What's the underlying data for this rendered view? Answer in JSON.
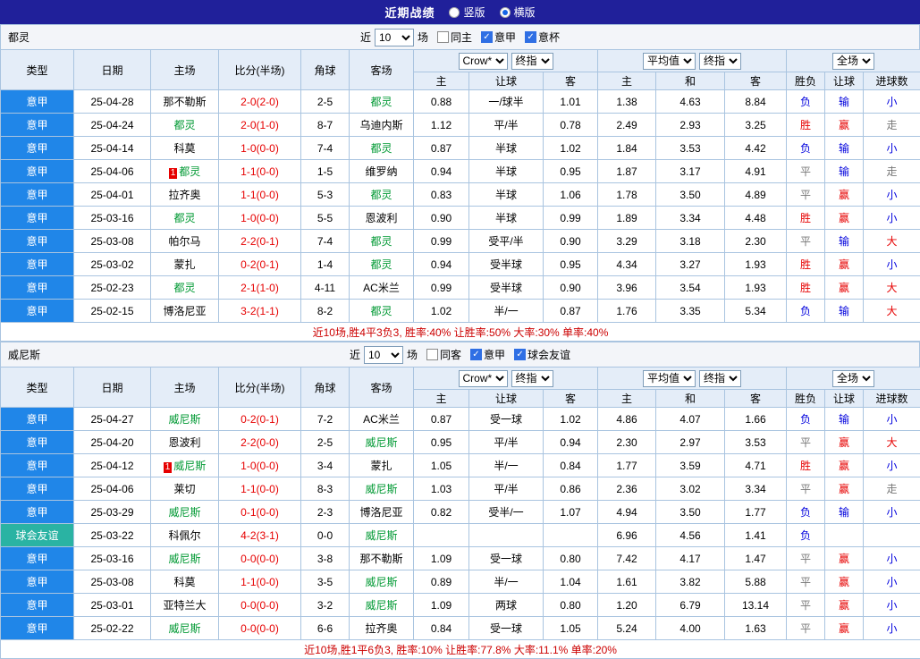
{
  "topbar": {
    "title": "近期战绩",
    "options": [
      {
        "label": "竖版",
        "selected": false
      },
      {
        "label": "横版",
        "selected": true
      }
    ]
  },
  "colors": {
    "topbar_bg": "#20209a",
    "league_blue": "#2086e8",
    "league_teal": "#2ab3a3",
    "focus_team_green": "#009933",
    "score_red": "#e60000",
    "win_red": "#e60000",
    "loss_blue": "#0000dd",
    "push_gray": "#777777",
    "header_bg": "#e4edf8",
    "grid_border": "#a9c4e0"
  },
  "table": {
    "main_columns": [
      "类型",
      "日期",
      "主场",
      "比分(半场)",
      "角球",
      "客场"
    ],
    "sub_columns": [
      "主",
      "让球",
      "客",
      "主",
      "和",
      "客",
      "胜负",
      "让球",
      "进球数"
    ]
  },
  "sections": [
    {
      "team": "都灵",
      "filter": {
        "near_label": "近",
        "count": "10",
        "games_label": "场",
        "checkboxes": [
          {
            "label": "同主",
            "checked": false
          },
          {
            "label": "意甲",
            "checked": true
          },
          {
            "label": "意杯",
            "checked": true
          }
        ]
      },
      "selects": {
        "bookmaker": "Crow*",
        "bookmaker_index": "终指",
        "average": "平均值",
        "average_index": "终指",
        "scope": "全场"
      },
      "rows": [
        {
          "league": "意甲",
          "league_color": "blue",
          "date": "25-04-28",
          "home": {
            "name": "那不勒斯",
            "focus": false,
            "red_card": ""
          },
          "score": "2-0(2-0)",
          "corners": "2-5",
          "away": {
            "name": "都灵",
            "focus": true,
            "red_card": ""
          },
          "odds": [
            "0.88",
            "一/球半",
            "1.01"
          ],
          "avg": [
            "1.38",
            "4.63",
            "8.84"
          ],
          "outcome": [
            {
              "t": "负",
              "c": "blue"
            },
            {
              "t": "输",
              "c": "blue"
            },
            {
              "t": "小",
              "c": "blue"
            }
          ]
        },
        {
          "league": "意甲",
          "league_color": "blue",
          "date": "25-04-24",
          "home": {
            "name": "都灵",
            "focus": true,
            "red_card": ""
          },
          "score": "2-0(1-0)",
          "corners": "8-7",
          "away": {
            "name": "乌迪内斯",
            "focus": false,
            "red_card": ""
          },
          "odds": [
            "1.12",
            "平/半",
            "0.78"
          ],
          "avg": [
            "2.49",
            "2.93",
            "3.25"
          ],
          "outcome": [
            {
              "t": "胜",
              "c": "red"
            },
            {
              "t": "赢",
              "c": "red"
            },
            {
              "t": "走",
              "c": "gray"
            }
          ]
        },
        {
          "league": "意甲",
          "league_color": "blue",
          "date": "25-04-14",
          "home": {
            "name": "科莫",
            "focus": false,
            "red_card": ""
          },
          "score": "1-0(0-0)",
          "corners": "7-4",
          "away": {
            "name": "都灵",
            "focus": true,
            "red_card": ""
          },
          "odds": [
            "0.87",
            "半球",
            "1.02"
          ],
          "avg": [
            "1.84",
            "3.53",
            "4.42"
          ],
          "outcome": [
            {
              "t": "负",
              "c": "blue"
            },
            {
              "t": "输",
              "c": "blue"
            },
            {
              "t": "小",
              "c": "blue"
            }
          ]
        },
        {
          "league": "意甲",
          "league_color": "blue",
          "date": "25-04-06",
          "home": {
            "name": "都灵",
            "focus": true,
            "red_card": "1"
          },
          "score": "1-1(0-0)",
          "corners": "1-5",
          "away": {
            "name": "维罗纳",
            "focus": false,
            "red_card": ""
          },
          "odds": [
            "0.94",
            "半球",
            "0.95"
          ],
          "avg": [
            "1.87",
            "3.17",
            "4.91"
          ],
          "outcome": [
            {
              "t": "平",
              "c": "gray"
            },
            {
              "t": "输",
              "c": "blue"
            },
            {
              "t": "走",
              "c": "gray"
            }
          ]
        },
        {
          "league": "意甲",
          "league_color": "blue",
          "date": "25-04-01",
          "home": {
            "name": "拉齐奥",
            "focus": false,
            "red_card": ""
          },
          "score": "1-1(0-0)",
          "corners": "5-3",
          "away": {
            "name": "都灵",
            "focus": true,
            "red_card": ""
          },
          "odds": [
            "0.83",
            "半球",
            "1.06"
          ],
          "avg": [
            "1.78",
            "3.50",
            "4.89"
          ],
          "outcome": [
            {
              "t": "平",
              "c": "gray"
            },
            {
              "t": "赢",
              "c": "red"
            },
            {
              "t": "小",
              "c": "blue"
            }
          ]
        },
        {
          "league": "意甲",
          "league_color": "blue",
          "date": "25-03-16",
          "home": {
            "name": "都灵",
            "focus": true,
            "red_card": ""
          },
          "score": "1-0(0-0)",
          "corners": "5-5",
          "away": {
            "name": "恩波利",
            "focus": false,
            "red_card": ""
          },
          "odds": [
            "0.90",
            "半球",
            "0.99"
          ],
          "avg": [
            "1.89",
            "3.34",
            "4.48"
          ],
          "outcome": [
            {
              "t": "胜",
              "c": "red"
            },
            {
              "t": "赢",
              "c": "red"
            },
            {
              "t": "小",
              "c": "blue"
            }
          ]
        },
        {
          "league": "意甲",
          "league_color": "blue",
          "date": "25-03-08",
          "home": {
            "name": "帕尔马",
            "focus": false,
            "red_card": ""
          },
          "score": "2-2(0-1)",
          "corners": "7-4",
          "away": {
            "name": "都灵",
            "focus": true,
            "red_card": ""
          },
          "odds": [
            "0.99",
            "受平/半",
            "0.90"
          ],
          "avg": [
            "3.29",
            "3.18",
            "2.30"
          ],
          "outcome": [
            {
              "t": "平",
              "c": "gray"
            },
            {
              "t": "输",
              "c": "blue"
            },
            {
              "t": "大",
              "c": "red"
            }
          ]
        },
        {
          "league": "意甲",
          "league_color": "blue",
          "date": "25-03-02",
          "home": {
            "name": "蒙扎",
            "focus": false,
            "red_card": ""
          },
          "score": "0-2(0-1)",
          "corners": "1-4",
          "away": {
            "name": "都灵",
            "focus": true,
            "red_card": ""
          },
          "odds": [
            "0.94",
            "受半球",
            "0.95"
          ],
          "avg": [
            "4.34",
            "3.27",
            "1.93"
          ],
          "outcome": [
            {
              "t": "胜",
              "c": "red"
            },
            {
              "t": "赢",
              "c": "red"
            },
            {
              "t": "小",
              "c": "blue"
            }
          ]
        },
        {
          "league": "意甲",
          "league_color": "blue",
          "date": "25-02-23",
          "home": {
            "name": "都灵",
            "focus": true,
            "red_card": ""
          },
          "score": "2-1(1-0)",
          "corners": "4-11",
          "away": {
            "name": "AC米兰",
            "focus": false,
            "red_card": ""
          },
          "odds": [
            "0.99",
            "受半球",
            "0.90"
          ],
          "avg": [
            "3.96",
            "3.54",
            "1.93"
          ],
          "outcome": [
            {
              "t": "胜",
              "c": "red"
            },
            {
              "t": "赢",
              "c": "red"
            },
            {
              "t": "大",
              "c": "red"
            }
          ]
        },
        {
          "league": "意甲",
          "league_color": "blue",
          "date": "25-02-15",
          "home": {
            "name": "博洛尼亚",
            "focus": false,
            "red_card": ""
          },
          "score": "3-2(1-1)",
          "corners": "8-2",
          "away": {
            "name": "都灵",
            "focus": true,
            "red_card": ""
          },
          "odds": [
            "1.02",
            "半/一",
            "0.87"
          ],
          "avg": [
            "1.76",
            "3.35",
            "5.34"
          ],
          "outcome": [
            {
              "t": "负",
              "c": "blue"
            },
            {
              "t": "输",
              "c": "blue"
            },
            {
              "t": "大",
              "c": "red"
            }
          ]
        }
      ],
      "summary": "近10场,胜4平3负3, 胜率:40% 让胜率:50% 大率:30% 单率:40%"
    },
    {
      "team": "威尼斯",
      "filter": {
        "near_label": "近",
        "count": "10",
        "games_label": "场",
        "checkboxes": [
          {
            "label": "同客",
            "checked": false
          },
          {
            "label": "意甲",
            "checked": true
          },
          {
            "label": "球会友谊",
            "checked": true
          }
        ]
      },
      "selects": {
        "bookmaker": "Crow*",
        "bookmaker_index": "终指",
        "average": "平均值",
        "average_index": "终指",
        "scope": "全场"
      },
      "rows": [
        {
          "league": "意甲",
          "league_color": "blue",
          "date": "25-04-27",
          "home": {
            "name": "威尼斯",
            "focus": true,
            "red_card": ""
          },
          "score": "0-2(0-1)",
          "corners": "7-2",
          "away": {
            "name": "AC米兰",
            "focus": false,
            "red_card": ""
          },
          "odds": [
            "0.87",
            "受一球",
            "1.02"
          ],
          "avg": [
            "4.86",
            "4.07",
            "1.66"
          ],
          "outcome": [
            {
              "t": "负",
              "c": "blue"
            },
            {
              "t": "输",
              "c": "blue"
            },
            {
              "t": "小",
              "c": "blue"
            }
          ]
        },
        {
          "league": "意甲",
          "league_color": "blue",
          "date": "25-04-20",
          "home": {
            "name": "恩波利",
            "focus": false,
            "red_card": ""
          },
          "score": "2-2(0-0)",
          "corners": "2-5",
          "away": {
            "name": "威尼斯",
            "focus": true,
            "red_card": ""
          },
          "odds": [
            "0.95",
            "平/半",
            "0.94"
          ],
          "avg": [
            "2.30",
            "2.97",
            "3.53"
          ],
          "outcome": [
            {
              "t": "平",
              "c": "gray"
            },
            {
              "t": "赢",
              "c": "red"
            },
            {
              "t": "大",
              "c": "red"
            }
          ]
        },
        {
          "league": "意甲",
          "league_color": "blue",
          "date": "25-04-12",
          "home": {
            "name": "威尼斯",
            "focus": true,
            "red_card": "1"
          },
          "score": "1-0(0-0)",
          "corners": "3-4",
          "away": {
            "name": "蒙扎",
            "focus": false,
            "red_card": ""
          },
          "odds": [
            "1.05",
            "半/一",
            "0.84"
          ],
          "avg": [
            "1.77",
            "3.59",
            "4.71"
          ],
          "outcome": [
            {
              "t": "胜",
              "c": "red"
            },
            {
              "t": "赢",
              "c": "red"
            },
            {
              "t": "小",
              "c": "blue"
            }
          ]
        },
        {
          "league": "意甲",
          "league_color": "blue",
          "date": "25-04-06",
          "home": {
            "name": "莱切",
            "focus": false,
            "red_card": ""
          },
          "score": "1-1(0-0)",
          "corners": "8-3",
          "away": {
            "name": "威尼斯",
            "focus": true,
            "red_card": ""
          },
          "odds": [
            "1.03",
            "平/半",
            "0.86"
          ],
          "avg": [
            "2.36",
            "3.02",
            "3.34"
          ],
          "outcome": [
            {
              "t": "平",
              "c": "gray"
            },
            {
              "t": "赢",
              "c": "red"
            },
            {
              "t": "走",
              "c": "gray"
            }
          ]
        },
        {
          "league": "意甲",
          "league_color": "blue",
          "date": "25-03-29",
          "home": {
            "name": "威尼斯",
            "focus": true,
            "red_card": ""
          },
          "score": "0-1(0-0)",
          "corners": "2-3",
          "away": {
            "name": "博洛尼亚",
            "focus": false,
            "red_card": ""
          },
          "odds": [
            "0.82",
            "受半/一",
            "1.07"
          ],
          "avg": [
            "4.94",
            "3.50",
            "1.77"
          ],
          "outcome": [
            {
              "t": "负",
              "c": "blue"
            },
            {
              "t": "输",
              "c": "blue"
            },
            {
              "t": "小",
              "c": "blue"
            }
          ]
        },
        {
          "league": "球会友谊",
          "league_color": "teal",
          "date": "25-03-22",
          "home": {
            "name": "科佩尔",
            "focus": false,
            "red_card": ""
          },
          "score": "4-2(3-1)",
          "corners": "0-0",
          "away": {
            "name": "威尼斯",
            "focus": true,
            "red_card": ""
          },
          "odds": [
            "",
            "",
            ""
          ],
          "avg": [
            "6.96",
            "4.56",
            "1.41"
          ],
          "outcome": [
            {
              "t": "负",
              "c": "blue"
            },
            {
              "t": "",
              "c": ""
            },
            {
              "t": "",
              "c": ""
            }
          ]
        },
        {
          "league": "意甲",
          "league_color": "blue",
          "date": "25-03-16",
          "home": {
            "name": "威尼斯",
            "focus": true,
            "red_card": ""
          },
          "score": "0-0(0-0)",
          "corners": "3-8",
          "away": {
            "name": "那不勒斯",
            "focus": false,
            "red_card": ""
          },
          "odds": [
            "1.09",
            "受一球",
            "0.80"
          ],
          "avg": [
            "7.42",
            "4.17",
            "1.47"
          ],
          "outcome": [
            {
              "t": "平",
              "c": "gray"
            },
            {
              "t": "赢",
              "c": "red"
            },
            {
              "t": "小",
              "c": "blue"
            }
          ]
        },
        {
          "league": "意甲",
          "league_color": "blue",
          "date": "25-03-08",
          "home": {
            "name": "科莫",
            "focus": false,
            "red_card": ""
          },
          "score": "1-1(0-0)",
          "corners": "3-5",
          "away": {
            "name": "威尼斯",
            "focus": true,
            "red_card": ""
          },
          "odds": [
            "0.89",
            "半/一",
            "1.04"
          ],
          "avg": [
            "1.61",
            "3.82",
            "5.88"
          ],
          "outcome": [
            {
              "t": "平",
              "c": "gray"
            },
            {
              "t": "赢",
              "c": "red"
            },
            {
              "t": "小",
              "c": "blue"
            }
          ]
        },
        {
          "league": "意甲",
          "league_color": "blue",
          "date": "25-03-01",
          "home": {
            "name": "亚特兰大",
            "focus": false,
            "red_card": ""
          },
          "score": "0-0(0-0)",
          "corners": "3-2",
          "away": {
            "name": "威尼斯",
            "focus": true,
            "red_card": ""
          },
          "odds": [
            "1.09",
            "两球",
            "0.80"
          ],
          "avg": [
            "1.20",
            "6.79",
            "13.14"
          ],
          "outcome": [
            {
              "t": "平",
              "c": "gray"
            },
            {
              "t": "赢",
              "c": "red"
            },
            {
              "t": "小",
              "c": "blue"
            }
          ]
        },
        {
          "league": "意甲",
          "league_color": "blue",
          "date": "25-02-22",
          "home": {
            "name": "威尼斯",
            "focus": true,
            "red_card": ""
          },
          "score": "0-0(0-0)",
          "corners": "6-6",
          "away": {
            "name": "拉齐奥",
            "focus": false,
            "red_card": ""
          },
          "odds": [
            "0.84",
            "受一球",
            "1.05"
          ],
          "avg": [
            "5.24",
            "4.00",
            "1.63"
          ],
          "outcome": [
            {
              "t": "平",
              "c": "gray"
            },
            {
              "t": "赢",
              "c": "red"
            },
            {
              "t": "小",
              "c": "blue"
            }
          ]
        }
      ],
      "summary": "近10场,胜1平6负3, 胜率:10% 让胜率:77.8% 大率:11.1% 单率:20%"
    }
  ]
}
